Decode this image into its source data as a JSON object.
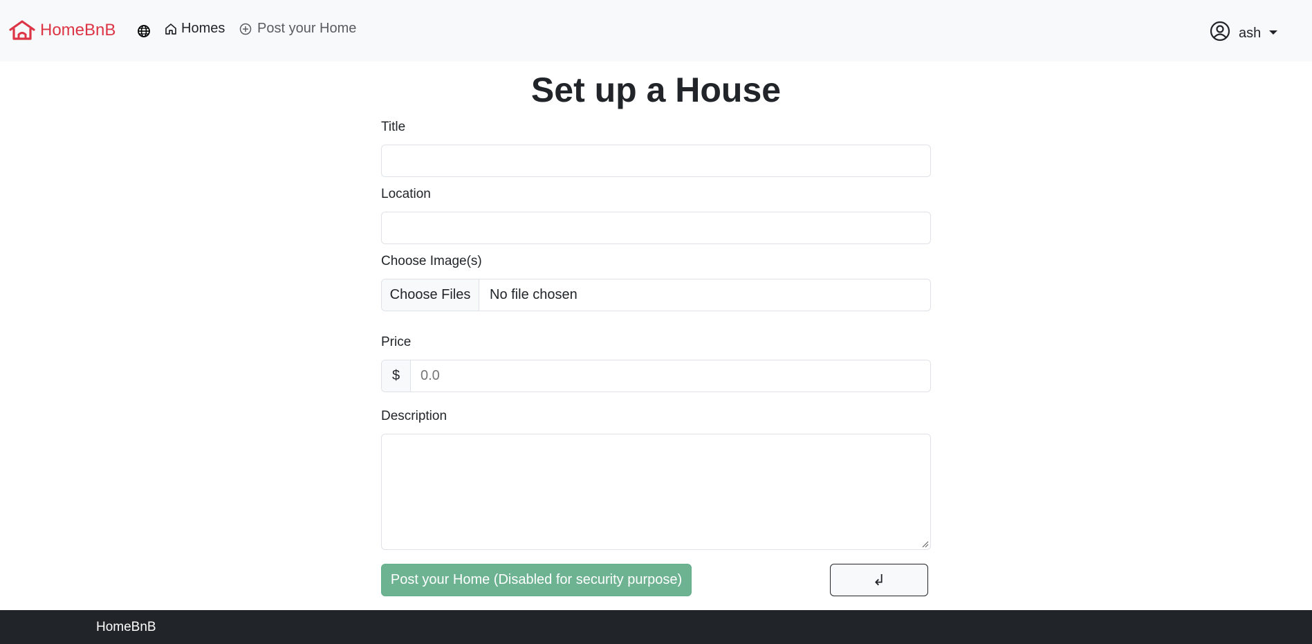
{
  "navbar": {
    "brand": "HomeBnB",
    "homes_label": "Homes",
    "post_label": "Post your Home",
    "user_name": "ash"
  },
  "page": {
    "title": "Set up a House"
  },
  "form": {
    "title_label": "Title",
    "title_value": "",
    "location_label": "Location",
    "location_value": "",
    "images_label": "Choose Image(s)",
    "images_button": "Choose Files",
    "images_status": "No file chosen",
    "price_label": "Price",
    "price_prefix": "$",
    "price_placeholder": "0.0",
    "description_label": "Description",
    "description_value": "",
    "submit_label": "Post your Home (Disabled for security purpose)",
    "back_label": "↲"
  },
  "footer": {
    "text": "HomeBnB"
  },
  "colors": {
    "brand": "#dc3545",
    "navbar_bg": "#f8f9fa",
    "submit_bg": "#6db392",
    "footer_bg": "#212529"
  }
}
